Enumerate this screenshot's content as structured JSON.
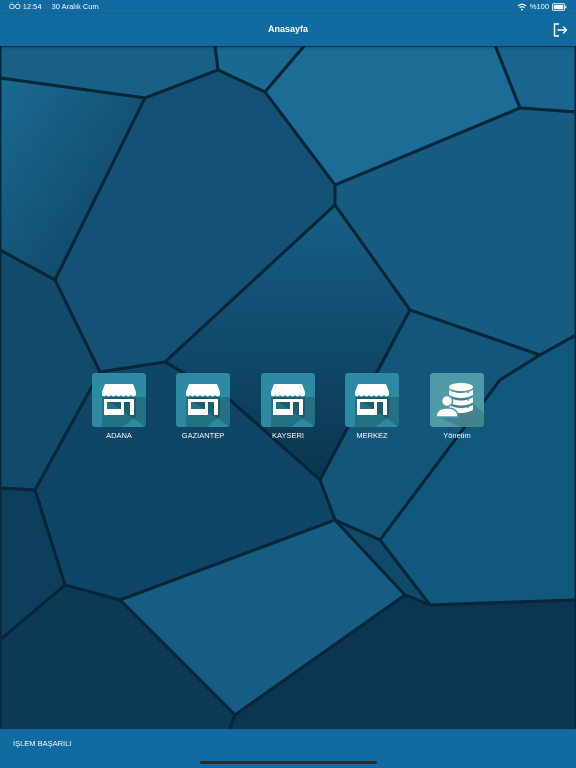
{
  "status_bar": {
    "time": "ÖÖ 12:54",
    "date": "30 Aralık Cum",
    "battery": "%100",
    "icons": [
      "wifi-icon",
      "battery-icon"
    ]
  },
  "nav": {
    "title": "Anasayfa",
    "logout_icon": "logout-icon"
  },
  "tiles": [
    {
      "label": "ADANA",
      "icon": "store-icon"
    },
    {
      "label": "GAZIANTEP",
      "icon": "store-icon"
    },
    {
      "label": "KAYSERI",
      "icon": "store-icon"
    },
    {
      "label": "MERKEZ",
      "icon": "store-icon"
    },
    {
      "label": "Yönetim",
      "icon": "database-user-icon"
    }
  ],
  "footer": {
    "status_message": "İŞLEM BAŞARILI"
  },
  "colors": {
    "bar": "#116aa0",
    "tile": "#2e8aa2",
    "tile_admin": "#4f9aa6",
    "background": "#0f4a6b"
  }
}
